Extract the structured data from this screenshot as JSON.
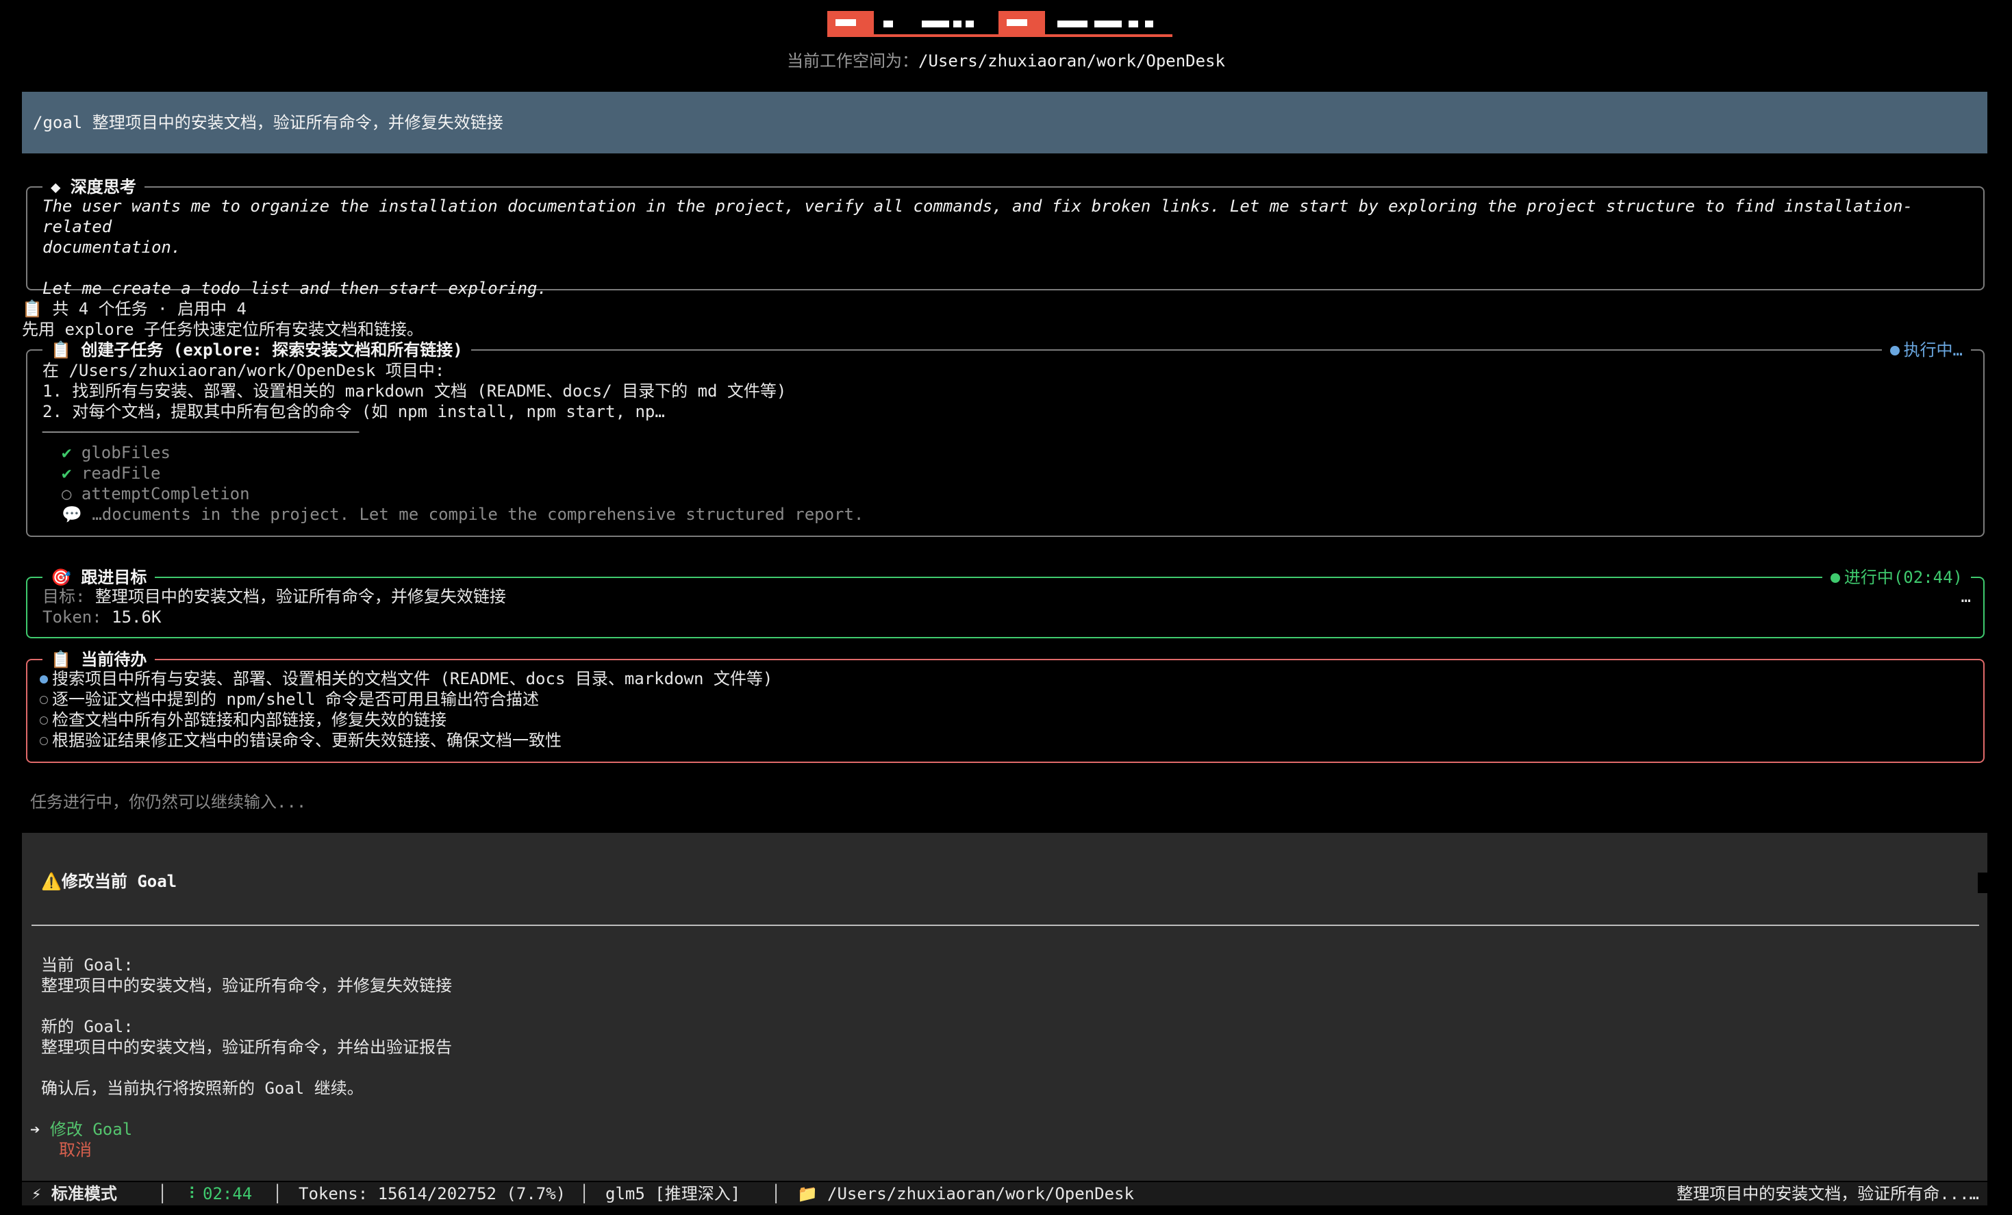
{
  "header": {
    "workspace_label": "当前工作空间为：",
    "workspace_path": "/Users/zhuxiaoran/work/OpenDesk"
  },
  "command": "/goal 整理项目中的安装文档，验证所有命令，并修复失效链接",
  "thinking": {
    "icon": "diamond-icon",
    "title": "◆ 深度思考",
    "line1": "The user wants me to organize the installation documentation in the project, verify all commands, and fix broken links. Let me start by exploring the project structure to find installation-related",
    "line2": "documentation.",
    "line3": "Let me create a todo list and then start exploring."
  },
  "task_summary": "📋 共 4 个任务 · 启用中 4",
  "explore_note": "先用 explore 子任务快速定位所有安装文档和链接。",
  "subtask": {
    "title": "📋 创建子任务 (explore: 探索安装文档和所有链接)",
    "status": "执行中…",
    "line1": "在 /Users/zhuxiaoran/work/OpenDesk 项目中:",
    "line2": "1. 找到所有与安装、部署、设置相关的 markdown 文档 (README、docs/ 目录下的 md 文件等)",
    "line3": "2. 对每个文档，提取其中所有包含的命令 (如 npm install, npm start, np…",
    "divider": "────────────────────────────────",
    "tools": [
      {
        "mark": "✔",
        "name": "globFiles",
        "done": true
      },
      {
        "mark": "✔",
        "name": "readFile",
        "done": true
      },
      {
        "mark": "○",
        "name": "attemptCompletion",
        "done": false
      }
    ],
    "message_icon": "💬",
    "message": "…documents in the project. Let me compile the comprehensive structured report."
  },
  "follow_goal": {
    "title": "🎯 跟进目标",
    "status": "进行中(02:44)",
    "goal_label": "目标:",
    "goal_value": "整理项目中的安装文档，验证所有命令，并修复失效链接",
    "more": "…",
    "token_label": "Token:",
    "token_value": "15.6K"
  },
  "todo": {
    "title": "📋 当前待办",
    "items": [
      {
        "text": "搜索项目中所有与安装、部署、设置相关的文档文件 (README、docs 目录、markdown 文件等)",
        "active": true
      },
      {
        "text": "逐一验证文档中提到的 npm/shell 命令是否可用且输出符合描述",
        "active": false
      },
      {
        "text": "检查文档中所有外部链接和内部链接，修复失效的链接",
        "active": false
      },
      {
        "text": "根据验证结果修正文档中的错误命令、更新失效链接、确保文档一致性",
        "active": false
      }
    ]
  },
  "hint": "任务进行中，你仍然可以继续输入...",
  "dialog": {
    "title": "⚠️修改当前 Goal",
    "current_label": "当前 Goal:",
    "current_value": "整理项目中的安装文档，验证所有命令，并修复失效链接",
    "new_label": "新的 Goal:",
    "new_value": "整理项目中的安装文档，验证所有命令，并给出验证报告",
    "confirm_note": "确认后，当前执行将按照新的 Goal 继续。",
    "pointer": "➔",
    "confirm_option": "修改 Goal",
    "cancel_option": "取消",
    "colors": {
      "confirm": "#54c46e",
      "cancel": "#d9604e"
    }
  },
  "statusbar": {
    "mode": "⚡ 标准模式",
    "timer_icon": "⠸",
    "timer": "02:44",
    "tokens": "Tokens: 15614/202752 (7.7%)",
    "model": "glm5 [推理深入]",
    "folder_icon": "📁",
    "path": "/Users/zhuxiaoran/work/OpenDesk",
    "goal_preview": "整理项目中的安装文档，验证所有命...…",
    "separator": "│"
  }
}
